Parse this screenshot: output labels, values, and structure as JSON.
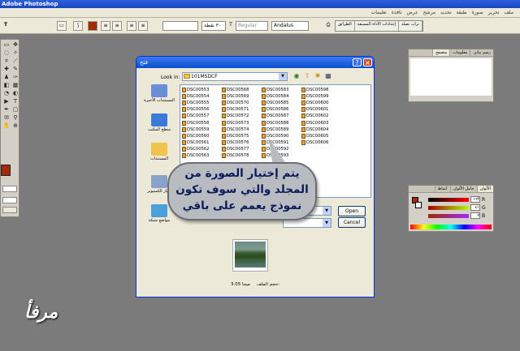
{
  "app": {
    "title": "Adobe Photoshop"
  },
  "menu": [
    "ملف",
    "تحرير",
    "صورة",
    "طبقة",
    "تحديد",
    "مرشح",
    "عرض",
    "نافذة",
    "تعليمات"
  ],
  "options_bar": {
    "font_size": "٣٠ نقطة",
    "style": "Regular",
    "anti_alias": "Andalus",
    "palette_tabs": [
      "تراب تصلد",
      "إعدادات الأداة المسبقة",
      "الطرائق"
    ]
  },
  "colors": {
    "foreground": "#a02a0c",
    "title_blue": "#0a4fd0",
    "callout_text": "#0a1a5a"
  },
  "navigator_panel": {
    "tabs": [
      "رسم بياني",
      "معلومات",
      "متصفح"
    ]
  },
  "color_panel": {
    "tabs": [
      "الألوان",
      "حامل الألوان",
      "أنماط"
    ],
    "values": [
      "١٦٣",
      "٤١",
      "٧"
    ],
    "channels": [
      "R",
      "G",
      "B"
    ]
  },
  "dialog": {
    "title": "فتح",
    "look_in_label": "Look in:",
    "look_in_value": "101MSDCF",
    "places": [
      "المستندات الأخيرة",
      "سطح المكتب",
      "المستندات",
      "جهاز الكمبيوتر",
      "مواضع شبكة"
    ],
    "files": [
      [
        "DSC00553",
        "DSC00568",
        "DSC00583",
        "DSC00598"
      ],
      [
        "DSC00554",
        "DSC00569",
        "DSC00584",
        "DSC00599"
      ],
      [
        "DSC00555",
        "DSC00570",
        "DSC00585",
        "DSC00600"
      ],
      [
        "DSC00556",
        "DSC00571",
        "DSC00586",
        "DSC00601"
      ],
      [
        "DSC00557",
        "DSC00572",
        "DSC00587",
        "DSC00602"
      ],
      [
        "DSC00558",
        "DSC00573",
        "DSC00588",
        "DSC00603"
      ],
      [
        "DSC00559",
        "DSC00574",
        "DSC00589",
        "DSC00604"
      ],
      [
        "DSC00560",
        "DSC00575",
        "DSC00590",
        "DSC00605"
      ],
      [
        "DSC00561",
        "DSC00576",
        "DSC00591",
        "DSC00606"
      ],
      [
        "DSC00562",
        "DSC00577",
        "DSC00592",
        ""
      ],
      [
        "DSC00563",
        "DSC00578",
        "DSC00593",
        ""
      ]
    ],
    "open_label": "Open",
    "cancel_label": "Cancel",
    "file_size_label": "حجم الملف:",
    "file_size_value": "ميجا 3.05"
  },
  "callout": {
    "line1": "يتم إختيار الصورة من",
    "line2": "المجلد والتي سوف تكون",
    "line3": "نموذج يعمم على باقي"
  },
  "signature": "مرفأ"
}
